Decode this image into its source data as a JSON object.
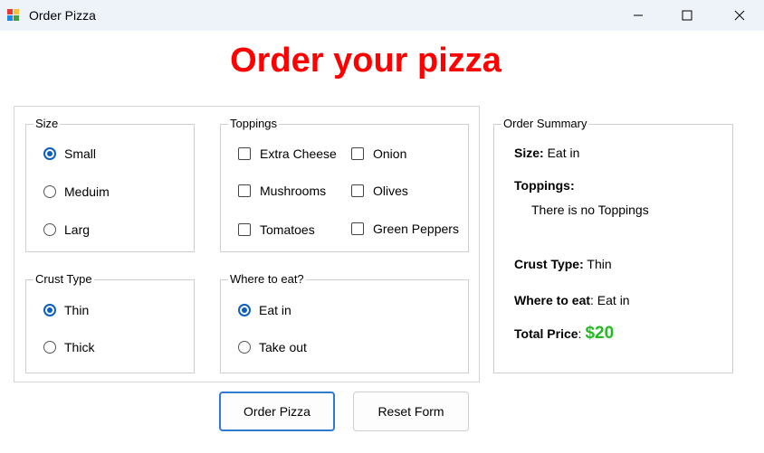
{
  "window": {
    "title": "Order Pizza",
    "controls": {
      "minimize_icon": "minimize-icon",
      "maximize_icon": "maximize-icon",
      "close_icon": "close-icon"
    }
  },
  "heading": {
    "text": "Order your pizza",
    "color": "#ff0000"
  },
  "size_group": {
    "title": "Size",
    "options": [
      {
        "label": "Small",
        "selected": true
      },
      {
        "label": "Meduim",
        "selected": false
      },
      {
        "label": "Larg",
        "selected": false
      }
    ]
  },
  "toppings_group": {
    "title": "Toppings",
    "options": [
      {
        "label": "Extra Cheese",
        "checked": false
      },
      {
        "label": "Onion",
        "checked": false
      },
      {
        "label": "Mushrooms",
        "checked": false
      },
      {
        "label": "Olives",
        "checked": false
      },
      {
        "label": "Tomatoes",
        "checked": false
      },
      {
        "label": "Green Peppers",
        "checked": false
      }
    ]
  },
  "crust_group": {
    "title": "Crust Type",
    "options": [
      {
        "label": "Thin",
        "selected": true
      },
      {
        "label": "Thick",
        "selected": false
      }
    ]
  },
  "where_group": {
    "title": "Where to eat?",
    "options": [
      {
        "label": "Eat in",
        "selected": true
      },
      {
        "label": "Take out",
        "selected": false
      }
    ]
  },
  "summary": {
    "title": "Order Summary",
    "size_label": "Size:",
    "size_value": "Eat in",
    "toppings_label": "Toppings:",
    "toppings_value": "There is no Toppings",
    "crust_label": "Crust Type:",
    "crust_value": "Thin",
    "where_label": "Where to eat",
    "where_value": ": Eat in",
    "total_label": "Total Price",
    "total_sep": ":",
    "total_value": "$20",
    "price_color": "#22bb22"
  },
  "buttons": {
    "order": "Order Pizza",
    "reset": "Reset Form"
  },
  "colors": {
    "accent": "#0a5fbf",
    "focus_border": "#2f7bd1"
  }
}
